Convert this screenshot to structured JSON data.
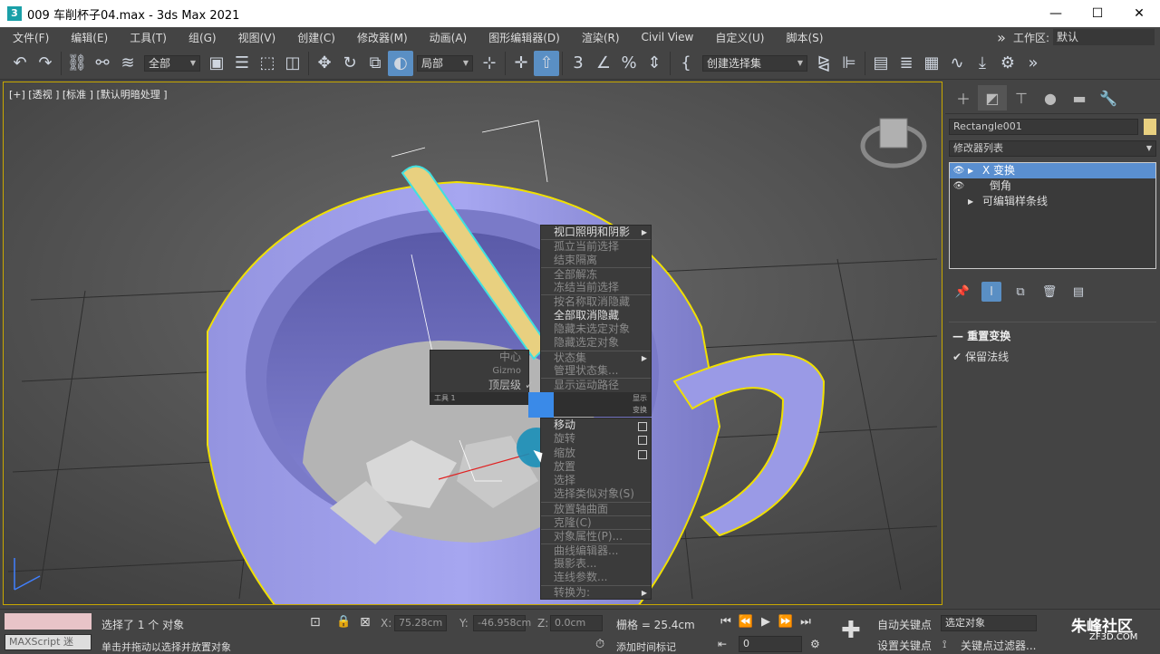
{
  "window": {
    "icon_letter": "3",
    "title": "009 车削杯子04.max - 3ds Max 2021",
    "minimize": "—",
    "maximize": "☐",
    "close": "✕"
  },
  "menubar": {
    "items": [
      "文件(F)",
      "编辑(E)",
      "工具(T)",
      "组(G)",
      "视图(V)",
      "创建(C)",
      "修改器(M)",
      "动画(A)",
      "图形编辑器(D)",
      "渲染(R)",
      "Civil View",
      "自定义(U)",
      "脚本(S)"
    ],
    "overflow": "»",
    "workspace_label": "工作区:",
    "workspace_value": "默认"
  },
  "toolbar": {
    "filter_dropdown": "全部",
    "coord_dropdown": "局部",
    "selection_set_dropdown": "创建选择集"
  },
  "viewport": {
    "label": "[+] [透视 ] [标准 ] [默认明暗处理 ]"
  },
  "quad_menu": {
    "top_right": [
      {
        "label": "视口照明和阴影",
        "state": "arrow"
      },
      {
        "label": "孤立当前选择",
        "state": "dis sep"
      },
      {
        "label": "结束隔离",
        "state": "dis"
      },
      {
        "label": "全部解冻",
        "state": "dis sep"
      },
      {
        "label": "冻结当前选择",
        "state": "dis"
      },
      {
        "label": "按名称取消隐藏",
        "state": "dis sep"
      },
      {
        "label": "全部取消隐藏",
        "state": ""
      },
      {
        "label": "隐藏未选定对象",
        "state": "dis"
      },
      {
        "label": "隐藏选定对象",
        "state": "dis"
      },
      {
        "label": "状态集",
        "state": "dis sep arrow"
      },
      {
        "label": "管理状态集...",
        "state": "dis"
      },
      {
        "label": "显示运动路径",
        "state": "dis sep"
      }
    ],
    "top_left": [
      {
        "label": "中心",
        "checked": false
      },
      {
        "label": "Gizmo",
        "checked": false
      },
      {
        "label": "顶层级",
        "checked": true
      }
    ],
    "tools1_title": "工具 1",
    "display_title": "显示",
    "transform_title": "变换",
    "bottom_right": [
      {
        "label": "移动",
        "state": "box"
      },
      {
        "label": "旋转",
        "state": "box dis"
      },
      {
        "label": "缩放",
        "state": "box dis"
      },
      {
        "label": "放置",
        "state": "dis"
      },
      {
        "label": "选择",
        "state": "dis"
      },
      {
        "label": "选择类似对象(S)",
        "state": "dis"
      },
      {
        "label": "放置轴曲面",
        "state": "dis sep"
      },
      {
        "label": "克隆(C)",
        "state": "dis sep"
      },
      {
        "label": "对象属性(P)...",
        "state": "dis sep"
      },
      {
        "label": "曲线编辑器...",
        "state": "dis sep"
      },
      {
        "label": "摄影表...",
        "state": "dis"
      },
      {
        "label": "连线参数...",
        "state": "dis"
      },
      {
        "label": "转换为:",
        "state": "dis sep arrow"
      }
    ]
  },
  "command_panel": {
    "object_name": "Rectangle001",
    "object_color": "#e8d080",
    "modifier_list_label": "修改器列表",
    "stack": [
      {
        "label": "X 变换",
        "selected": true,
        "eye": true,
        "expand": true
      },
      {
        "label": "倒角",
        "selected": false,
        "eye": true,
        "expand": false
      },
      {
        "label": "可编辑样条线",
        "selected": false,
        "eye": false,
        "expand": true
      }
    ],
    "rollout_title": "重置变换",
    "checkbox_label": "保留法线",
    "checkbox_checked": true
  },
  "status_bar": {
    "maxscript_label": "MAXScript 迷",
    "selection_text": "选择了 1 个 对象",
    "hint_text": "单击并拖动以选择并放置对象",
    "x_label": "X:",
    "x_value": "75.28cm",
    "y_label": "Y:",
    "y_value": "-46.958cm",
    "z_label": "Z:",
    "z_value": "0.0cm",
    "grid_text": "栅格 = 25.4cm",
    "add_time_tag": "添加时间标记",
    "frame_value": "0",
    "auto_key": "自动关键点",
    "set_key": "设置关键点",
    "selected_object": "选定对象",
    "key_filters": "关键点过滤器...",
    "watermark": "朱峰社区",
    "watermark_url": "ZF3D.COM"
  }
}
